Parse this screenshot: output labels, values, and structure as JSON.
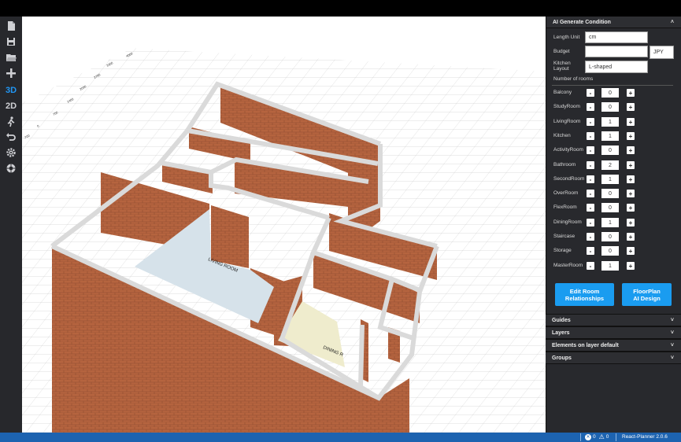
{
  "toolbar": {
    "items": [
      {
        "name": "new-file-icon"
      },
      {
        "name": "save-icon"
      },
      {
        "name": "open-folder-icon"
      },
      {
        "name": "add-icon"
      },
      {
        "name": "view-3d",
        "label": "3D"
      },
      {
        "name": "view-2d",
        "label": "2D"
      },
      {
        "name": "walk-icon"
      },
      {
        "name": "undo-icon"
      },
      {
        "name": "settings-icon"
      },
      {
        "name": "camera-icon"
      }
    ]
  },
  "scene": {
    "room_labels": [
      "LIVING ROOM",
      "DINING R"
    ],
    "ruler_labels": [
      "4060",
      "3360",
      "2780",
      "2090",
      "1400",
      "700",
      "0",
      "-700"
    ]
  },
  "sidebar": {
    "ai_panel": {
      "title": "AI Generate Condition",
      "length_unit_label": "Length Unit",
      "length_unit_value": "cm",
      "budget_label": "Budget",
      "budget_value": "",
      "currency": "JPY",
      "kitchen_layout_label_line1": "Kitchen",
      "kitchen_layout_label_line2": "Layout",
      "kitchen_layout_value": "L-shaped",
      "number_of_rooms_label": "Number of rooms",
      "rooms": [
        {
          "label": "Balcony",
          "count": "0"
        },
        {
          "label": "StudyRoom",
          "count": "0"
        },
        {
          "label": "LivingRoom",
          "count": "1"
        },
        {
          "label": "Kitchen",
          "count": "1"
        },
        {
          "label": "ActivityRoom",
          "count": "0"
        },
        {
          "label": "Bathroom",
          "count": "2"
        },
        {
          "label": "SecondRoom",
          "count": "1"
        },
        {
          "label": "OverRoom",
          "count": "0"
        },
        {
          "label": "FlexRoom",
          "count": "0"
        },
        {
          "label": "DiningRoom",
          "count": "1"
        },
        {
          "label": "Staircase",
          "count": "0"
        },
        {
          "label": "Storage",
          "count": "0"
        },
        {
          "label": "MasterRoom",
          "count": "1"
        }
      ],
      "minus_label": "-",
      "plus_label": "+",
      "edit_button_line1": "Edit Room",
      "edit_button_line2": "Relationships",
      "design_button_line1": "FloorPlan",
      "design_button_line2": "AI Design"
    },
    "accordion": [
      {
        "label": "Guides"
      },
      {
        "label": "Layers"
      },
      {
        "label": "Elements on layer default"
      },
      {
        "label": "Groups"
      }
    ]
  },
  "statusbar": {
    "errors_count": "0",
    "warnings_count": "0",
    "version": "React-Planner 2.0.6"
  },
  "colors": {
    "accent": "#1a9cf0",
    "statusbar": "#1d63b0",
    "brick": "#b5643f",
    "wall_top": "#d9d9d9",
    "living_floor": "#d6e2ea",
    "dining_floor": "#efeccd"
  }
}
